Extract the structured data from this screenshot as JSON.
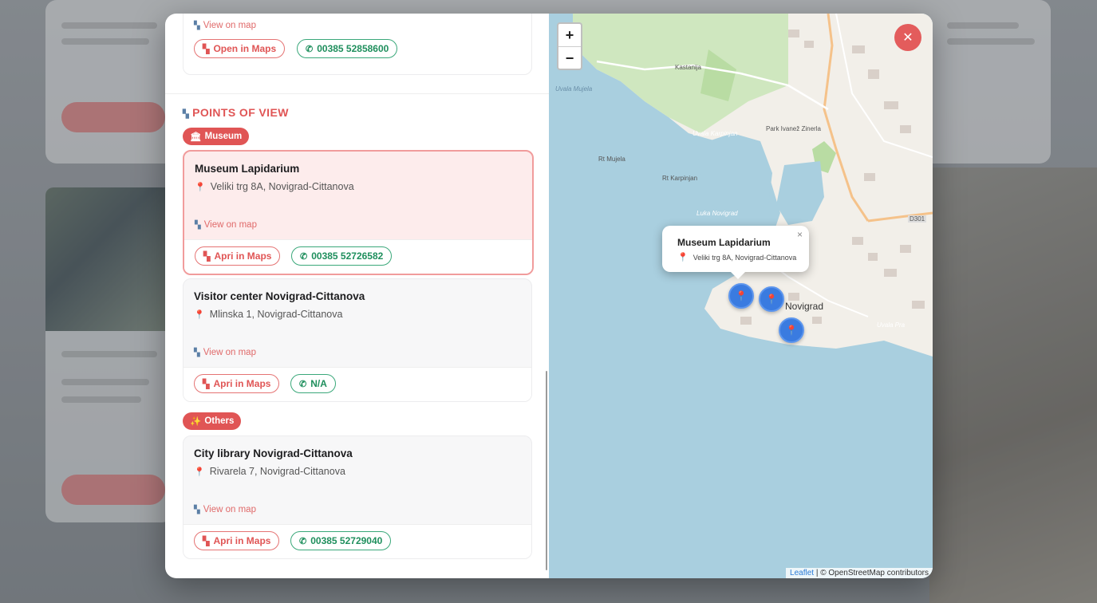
{
  "top_card": {
    "view_on_map": "View on map",
    "maps_button": "Open in Maps",
    "phone": "00385 52858600"
  },
  "section": {
    "title": "POINTS OF VIEW"
  },
  "categories": [
    {
      "label": "Museum"
    },
    {
      "label": "Others"
    }
  ],
  "places": [
    {
      "name": "Museum Lapidarium",
      "address": "Veliki trg 8A, Novigrad-Cittanova",
      "view_on_map": "View on map",
      "maps_button": "Apri in Maps",
      "phone": "00385 52726582"
    },
    {
      "name": "Visitor center Novigrad-Cittanova",
      "address": "Mlinska 1, Novigrad-Cittanova",
      "view_on_map": "View on map",
      "maps_button": "Apri in Maps",
      "phone": "N/A"
    },
    {
      "name": "City library Novigrad-Cittanova",
      "address": "Rivarela 7, Novigrad-Cittanova",
      "view_on_map": "View on map",
      "maps_button": "Apri in Maps",
      "phone": "00385 52729040"
    }
  ],
  "map": {
    "zoom_in": "+",
    "zoom_out": "−",
    "close": "✕",
    "popup_title": "Museum Lapidarium",
    "popup_address": "Veliki trg 8A, Novigrad-Cittanova",
    "popup_close": "×",
    "attribution_leaflet": "Leaflet",
    "attribution_rest": " | © OpenStreetMap contributors",
    "labels": [
      "Uvala Mujela",
      "Rt Mujela",
      "Rt Karpinjan",
      "Uvala Karpinjan",
      "Luka Novigrad",
      "Novigrad",
      "Uvala Pra",
      "D301",
      "Kastanija",
      "Park Ivanež Zinerla"
    ]
  },
  "colors": {
    "accent_red": "#e05555",
    "accent_green": "#1f8f5d",
    "marker_blue": "#3a7be0"
  },
  "icons": {
    "map": "map-icon",
    "pin": "pin-icon",
    "phone": "phone-icon",
    "museum": "museum-icon",
    "sparkles": "sparkles-icon"
  }
}
